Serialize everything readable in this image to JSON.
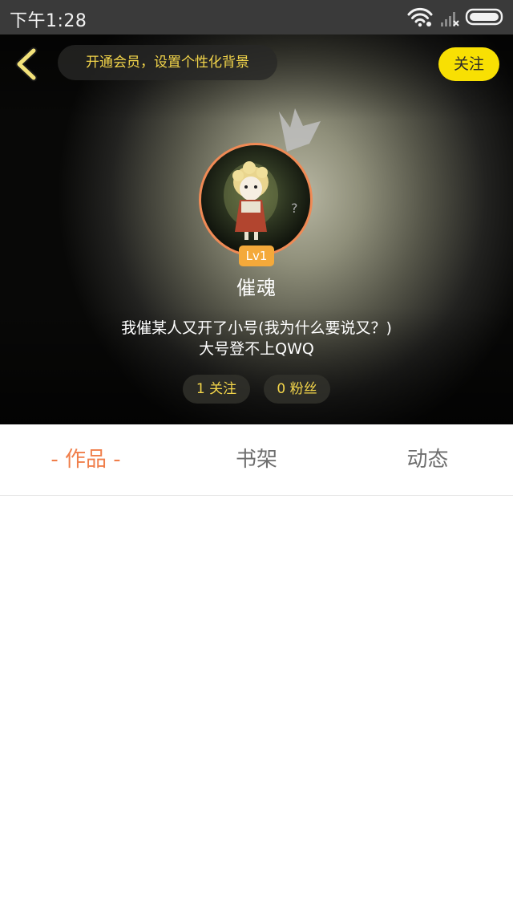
{
  "status_bar": {
    "time": "下午1:28",
    "icons": [
      "wifi-icon",
      "signal-icon",
      "battery-icon"
    ]
  },
  "header": {
    "back_icon": "chevron-left-icon",
    "vip_banner": "开通会员，设置个性化背景",
    "follow_button": "关注"
  },
  "profile": {
    "level": "Lv1",
    "username": "催魂",
    "bio_lines": [
      "我催某人又开了小号(我为什么要说又？)",
      "大号登不上QWQ"
    ],
    "following": "1 关注",
    "fans": "0 粉丝"
  },
  "tabs": {
    "works": {
      "label": "作品",
      "active": true
    },
    "shelf": {
      "label": "书架",
      "active": false
    },
    "feed": {
      "label": "动态",
      "active": false
    }
  },
  "colors": {
    "status_bar": "#3a3a3a",
    "accent_yellow": "#f8e003",
    "vip_text": "#f3d54a",
    "active_tab": "#f07e4a",
    "inactive_tab": "#6e6e6e",
    "level_badge": "#f4a93a",
    "avatar_ring": "#f08a55"
  }
}
